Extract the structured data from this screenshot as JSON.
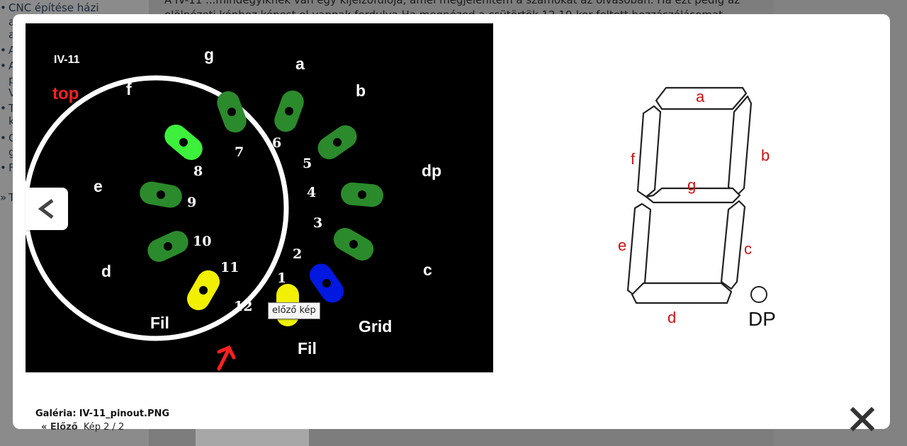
{
  "background": {
    "sidebar_items": [
      {
        "bullet": "•",
        "text": "CNC építése házi"
      },
      {
        "bullet": "",
        "text": "a"
      },
      {
        "bullet": "",
        "text": "a"
      },
      {
        "bullet": "•",
        "text": "A"
      },
      {
        "bullet": "•",
        "text": "A"
      },
      {
        "bullet": "",
        "text": "p"
      },
      {
        "bullet": "",
        "text": "V"
      },
      {
        "bullet": "•",
        "text": "T"
      },
      {
        "bullet": "",
        "text": "k"
      },
      {
        "bullet": "•",
        "text": "C"
      },
      {
        "bullet": "",
        "text": "g"
      },
      {
        "bullet": "•",
        "text": "F"
      },
      {
        "bullet": "»",
        "text": "T"
      }
    ],
    "article_line_1": "A IV-11 ...mindegyiknek van egy kijelzőfulója, amel megjelenítem a számokat az olvasóban. Ha ezt pedig az",
    "article_line_2": "elölnézeti képhez képest el vannak fordulva.Ha megnézed a csütörtök 12.19-kor feltett hozzászólásomat,"
  },
  "photo": {
    "tube_label": "IV-11",
    "view_label": "top",
    "segment_labels": {
      "g": "g",
      "a": "a",
      "f": "f",
      "b": "b",
      "e": "e",
      "dp": "dp",
      "d": "d",
      "c": "c"
    },
    "pin_numbers": [
      "1",
      "2",
      "3",
      "4",
      "5",
      "6",
      "7",
      "8",
      "9",
      "10",
      "11",
      "12"
    ],
    "fil_left": "Fil",
    "fil_bottom": "Fil",
    "grid_label": "Grid",
    "colors": {
      "background": "#000000",
      "pin_green": "#2b8a2b",
      "pin_lightgreen": "#3cf03c",
      "pin_yellow": "#f0f000",
      "pin_blue": "#0018e0",
      "label_red": "#ff2020"
    }
  },
  "diagram": {
    "labels": {
      "a": "a",
      "b": "b",
      "c": "c",
      "d": "d",
      "e": "e",
      "f": "f",
      "g": "g"
    },
    "dp_label": "DP",
    "label_color": "#cc1111"
  },
  "tooltip": {
    "text": "előző kép"
  },
  "caption": {
    "gallery_label": "Galéria:",
    "file_name": "IV-11_pinout.PNG"
  },
  "nav": {
    "prev_label": "« Előző",
    "counter": "Kép 2 / 2"
  },
  "icons": {
    "prev": "chevron-left-icon",
    "close": "close-icon"
  }
}
